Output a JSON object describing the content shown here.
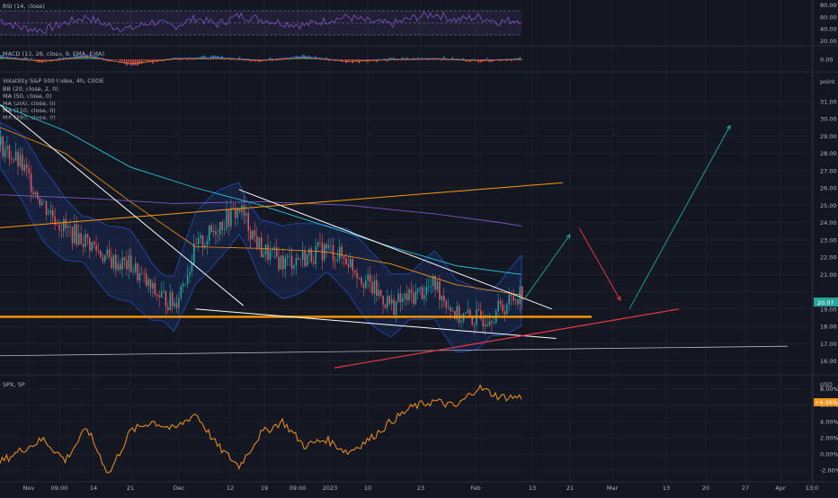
{
  "chart_data": [
    {
      "type": "line",
      "panel": "rsi",
      "title": "RSI (14, close)",
      "y_ticks": [
        80.0,
        60.0,
        40.0,
        20.0
      ],
      "ylim": [
        15,
        85
      ],
      "bands": [
        30,
        70
      ],
      "x": [
        0,
        5,
        10,
        15,
        20,
        25,
        30,
        35,
        40,
        45,
        50,
        55,
        60,
        65,
        70,
        75,
        80,
        85,
        90,
        95,
        100,
        105,
        110,
        115,
        120
      ],
      "values": [
        55,
        42,
        38,
        50,
        60,
        45,
        40,
        52,
        44,
        58,
        48,
        62,
        56,
        50,
        46,
        54,
        60,
        52,
        48,
        58,
        65,
        55,
        60,
        52,
        56
      ],
      "color": "#7e57c2"
    },
    {
      "type": "line",
      "panel": "macd",
      "title": "MACD (12, 26, close, 9, EMA, EMA)",
      "y_ticks": [
        0.0
      ],
      "ylim": [
        -1,
        1
      ],
      "x": [
        0,
        10,
        20,
        30,
        40,
        50,
        60,
        70,
        80,
        90,
        100,
        110,
        120
      ],
      "values": [
        0.3,
        -0.2,
        0.4,
        -0.5,
        0.1,
        0.2,
        -0.1,
        0.3,
        -0.2,
        0.0,
        0.1,
        -0.1,
        0.05
      ]
    },
    {
      "type": "candlestick",
      "panel": "main",
      "title": "Volatility S&P 500 Index, 4h, CBOE",
      "legend": [
        "BB (20, close, 2, 0)",
        "MA (50, close, 0)",
        "MA (200, close, 0)",
        "MA (110, close, 0)",
        "MA (380, close, 0)"
      ],
      "unit": "point",
      "y_ticks": [
        31.0,
        30.0,
        29.0,
        28.0,
        27.0,
        26.0,
        25.0,
        24.0,
        23.0,
        22.0,
        21.0,
        20.0,
        19.0,
        18.0,
        17.0,
        16.0
      ],
      "ylim": [
        15.3,
        32.6
      ],
      "last_price": "20.07",
      "x": [
        0,
        5,
        10,
        15,
        20,
        25,
        30,
        35,
        40,
        45,
        50,
        55,
        60,
        65,
        70,
        75,
        80,
        85,
        90,
        95,
        100,
        105,
        110,
        115,
        120
      ],
      "values": [
        28.5,
        27.2,
        25.0,
        23.6,
        22.9,
        21.8,
        21.5,
        20.0,
        19.3,
        22.5,
        23.8,
        24.8,
        22.4,
        21.7,
        22.0,
        22.5,
        21.8,
        20.3,
        19.2,
        19.8,
        20.4,
        18.6,
        18.4,
        19.0,
        20.07
      ]
    },
    {
      "type": "line",
      "panel": "spx",
      "title": "SPX, SP",
      "unit": "USD",
      "y_ticks": [
        8.0,
        6.0,
        4.0,
        2.0,
        0.0,
        -2.0
      ],
      "ylim": [
        -3.2,
        9.5
      ],
      "last_value": "+6.96%",
      "x": [
        0,
        5,
        10,
        15,
        20,
        25,
        30,
        35,
        40,
        45,
        50,
        55,
        60,
        65,
        70,
        75,
        80,
        85,
        90,
        95,
        100,
        105,
        110,
        115,
        120
      ],
      "values": [
        -1.0,
        0.5,
        1.8,
        -0.8,
        3.2,
        -2.5,
        2.8,
        4.0,
        3.0,
        5.0,
        1.0,
        -1.5,
        2.5,
        4.0,
        1.0,
        1.8,
        0.2,
        1.8,
        4.0,
        5.8,
        6.5,
        5.8,
        8.2,
        7.0,
        6.96
      ],
      "color": "#f7931a"
    }
  ],
  "x_axis": {
    "ticks": [
      "Nov",
      "09:00",
      "14",
      "21",
      "Dec",
      "12",
      "19",
      "09:00",
      "2023",
      "10",
      "23",
      "Feb",
      "13",
      "21",
      "Mar",
      "13",
      "20",
      "27",
      "Apr",
      "13:0"
    ]
  },
  "colors": {
    "background": "#131722",
    "up": "#26a69a",
    "down": "#ef5350",
    "bb_fill": "#2962ff",
    "ma50": "#f7931a",
    "ma200": "#7e57c2",
    "ma110": "#26c6da",
    "orange_line": "#ff9800",
    "red_line": "#f23645",
    "white_line": "#ffffff",
    "green_arrow": "#26a69a",
    "red_arrow": "#f23645",
    "last_price_tag": "#26a69a"
  }
}
